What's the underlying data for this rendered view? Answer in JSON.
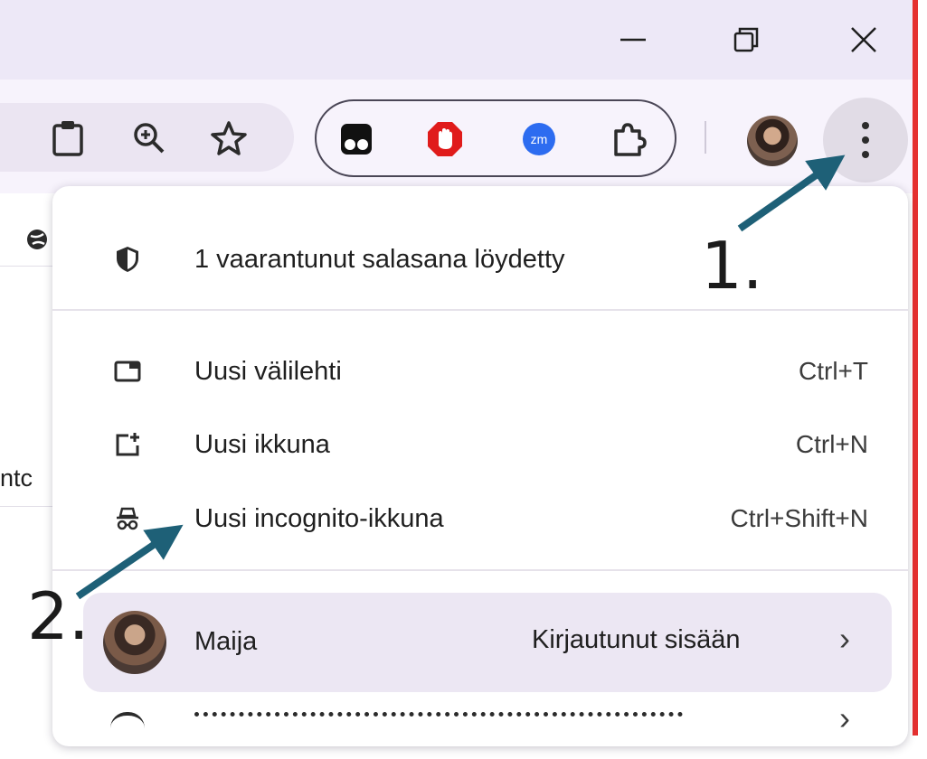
{
  "window": {
    "controls": [
      {
        "name": "minimize",
        "glyph": "—"
      },
      {
        "name": "restore",
        "glyph": "❐"
      },
      {
        "name": "close",
        "glyph": "✕"
      }
    ]
  },
  "toolbar": {
    "icons": [
      "clipboard-icon",
      "zoom-icon",
      "bookmark-star-icon"
    ],
    "extensions": [
      "tampermonkey-extension-icon",
      "adblock-extension-icon",
      "zoom-meeting-extension-icon",
      "extensions-puzzle-icon"
    ],
    "zoom_ext_text": "zm"
  },
  "page": {
    "partial_text": "ntc"
  },
  "menu": {
    "alert": {
      "label": "1 vaarantunut salasana löydetty",
      "icon": "shield-icon"
    },
    "items": [
      {
        "label": "Uusi välilehti",
        "shortcut": "Ctrl+T",
        "icon": "new-tab-icon"
      },
      {
        "label": "Uusi ikkuna",
        "shortcut": "Ctrl+N",
        "icon": "new-window-icon"
      },
      {
        "label": "Uusi incognito-ikkuna",
        "shortcut": "Ctrl+Shift+N",
        "icon": "incognito-icon"
      }
    ],
    "profile": {
      "name": "Maija",
      "status": "Kirjautunut sisään",
      "chevron": "›"
    },
    "cut_off_chevron": "›"
  },
  "annotations": {
    "step1": "1.",
    "step2": "2."
  },
  "colors": {
    "arrow": "#1e6077",
    "titlebar": "#ede8f7",
    "toolbar": "#f7f3fc",
    "profile_bg": "#ece7f3"
  }
}
